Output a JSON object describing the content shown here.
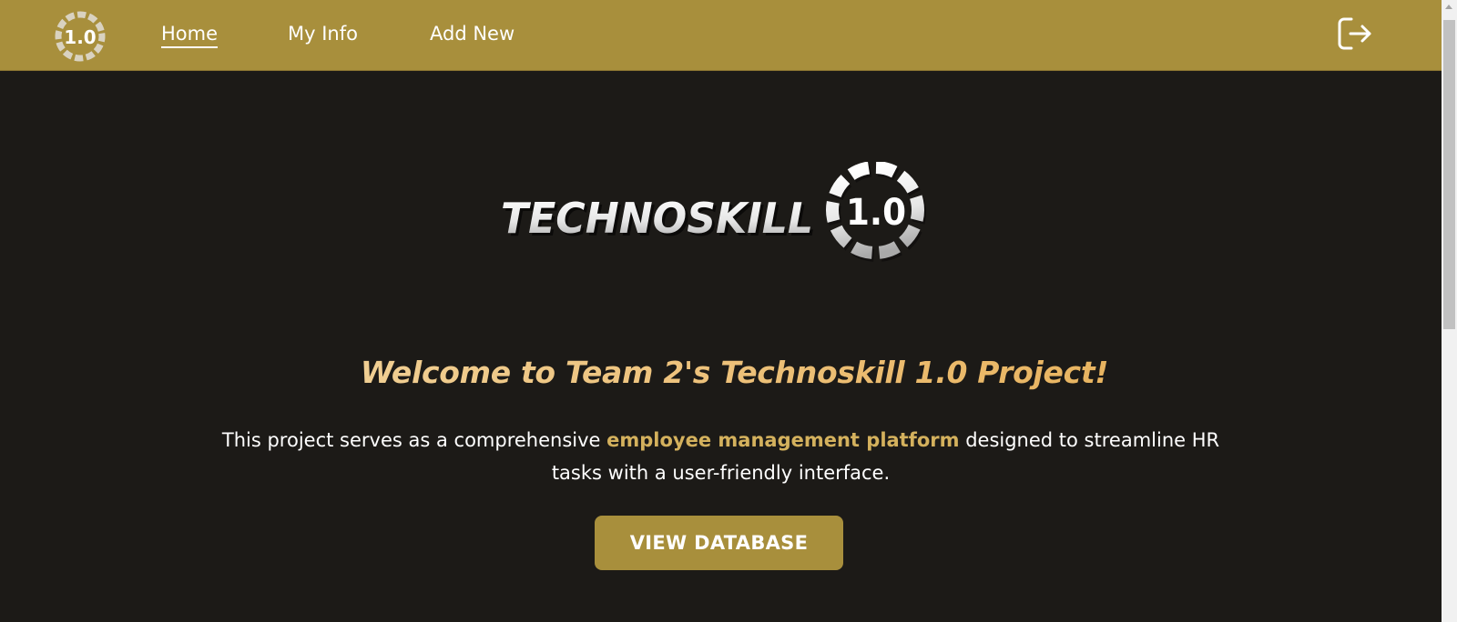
{
  "brand": {
    "logo_wordmark": "TECHNOSKILL",
    "logo_badge": "1.0",
    "accent_color": "#a88f3c",
    "background_color": "#1c1a17"
  },
  "nav": {
    "items": [
      {
        "label": "Home",
        "active": true
      },
      {
        "label": "My Info",
        "active": false
      },
      {
        "label": "Add New",
        "active": false
      }
    ],
    "logout_icon": "logout-icon"
  },
  "hero": {
    "heading": "Welcome to Team 2's Technoskill 1.0 Project!",
    "description_before": "This project serves as a comprehensive ",
    "description_highlight": "employee management platform",
    "description_after": " designed to streamline HR tasks with a user-friendly interface.",
    "cta_label": "VIEW DATABASE",
    "highlight_color": "#d4b15d"
  }
}
